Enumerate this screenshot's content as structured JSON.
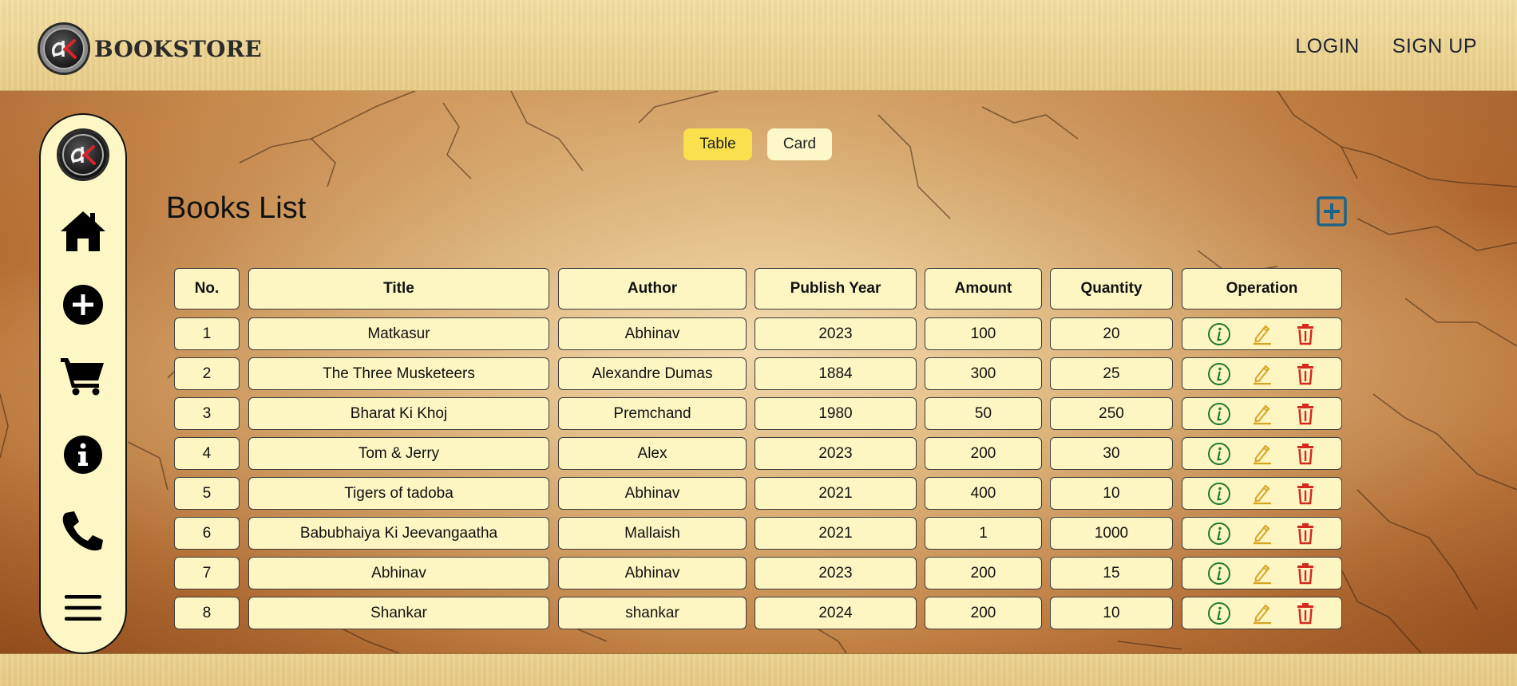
{
  "header": {
    "brand": "BOOKSTORE",
    "logo_text": "ak",
    "nav": {
      "login": "LOGIN",
      "signup": "SIGN UP"
    }
  },
  "sidebar": {
    "items": [
      {
        "name": "logo",
        "icon": "ak-logo"
      },
      {
        "name": "home",
        "icon": "home-icon"
      },
      {
        "name": "add",
        "icon": "plus-circle-icon"
      },
      {
        "name": "cart",
        "icon": "cart-icon"
      },
      {
        "name": "about",
        "icon": "info-circle-icon"
      },
      {
        "name": "contact",
        "icon": "phone-icon"
      },
      {
        "name": "menu",
        "icon": "hamburger-menu-icon"
      }
    ]
  },
  "view_toggle": {
    "table": "Table",
    "card": "Card",
    "active": "Table"
  },
  "page_title": "Books List",
  "table": {
    "columns": [
      "No.",
      "Title",
      "Author",
      "Publish Year",
      "Amount",
      "Quantity",
      "Operation"
    ],
    "rows": [
      [
        "1",
        "Matkasur",
        "Abhinav",
        "2023",
        "100",
        "20"
      ],
      [
        "2",
        "The Three Musketeers",
        "Alexandre Dumas",
        "1884",
        "300",
        "25"
      ],
      [
        "3",
        "Bharat Ki Khoj",
        "Premchand",
        "1980",
        "50",
        "250"
      ],
      [
        "4",
        "Tom & Jerry",
        "Alex",
        "2023",
        "200",
        "30"
      ],
      [
        "5",
        "Tigers of tadoba",
        "Abhinav",
        "2021",
        "400",
        "10"
      ],
      [
        "6",
        "Babubhaiya Ki Jeevangaatha",
        "Mallaish",
        "2021",
        "1",
        "1000"
      ],
      [
        "7",
        "Abhinav",
        "Abhinav",
        "2023",
        "200",
        "15"
      ],
      [
        "8",
        "Shankar",
        "shankar",
        "2024",
        "200",
        "10"
      ]
    ],
    "operation_icons": [
      "info-icon",
      "edit-pencil-icon",
      "delete-trash-icon"
    ]
  },
  "colors": {
    "header_bg": "#ecd391",
    "sidebar_bg": "#fdf7c6",
    "cell_bg": "#fdf6c3",
    "toggle_active": "#fbe04d",
    "add_button": "#1e6489",
    "info_icon": "#1f7a30",
    "edit_icon": "#d9a320",
    "delete_icon": "#d42a1e"
  }
}
